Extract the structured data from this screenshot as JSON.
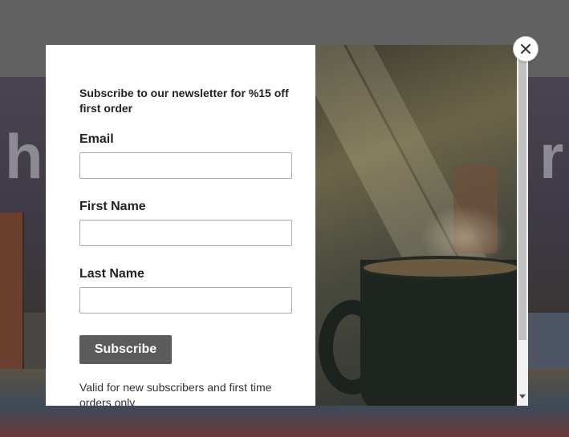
{
  "background": {
    "word_left": "h",
    "word_right": "r!"
  },
  "modal": {
    "headline": "Subscribe to our newsletter for %15 off first order",
    "fields": [
      {
        "label": "Email",
        "value": "",
        "placeholder": ""
      },
      {
        "label": "First Name",
        "value": "",
        "placeholder": ""
      },
      {
        "label": "Last Name",
        "value": "",
        "placeholder": ""
      }
    ],
    "submit_label": "Subscribe",
    "note": "Valid for new subscribers and first time orders only"
  },
  "icons": {
    "close": "close-icon",
    "scroll_down": "chevron-down-icon"
  },
  "colors": {
    "button_bg": "#5c5c5c",
    "overlay": "#5e5e5e"
  }
}
